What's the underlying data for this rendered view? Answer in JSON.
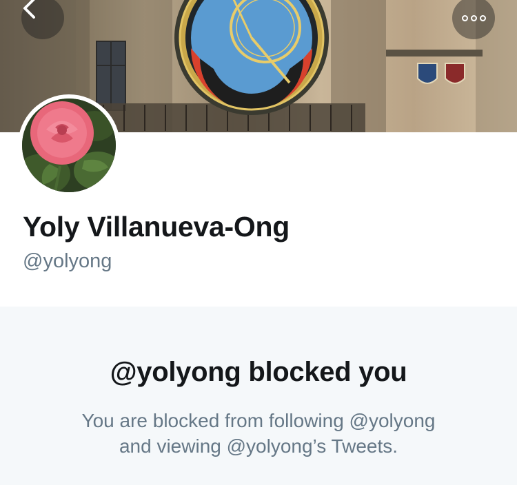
{
  "header": {
    "back_icon": "chevron-left-icon",
    "more_icon": "more-horizontal-icon",
    "banner_image": "astronomical-clock-photo"
  },
  "profile": {
    "avatar_image": "pink-rose-photo",
    "display_name": "Yoly Villanueva-Ong",
    "handle": "@yolyong"
  },
  "blocked": {
    "title": "@yolyong blocked you",
    "message_line1": "You are blocked from following @yolyong",
    "message_line2": "and viewing @yolyong’s Tweets."
  },
  "colors": {
    "text_primary": "#14171a",
    "text_secondary": "#657786",
    "panel_background": "#f5f8fa"
  }
}
